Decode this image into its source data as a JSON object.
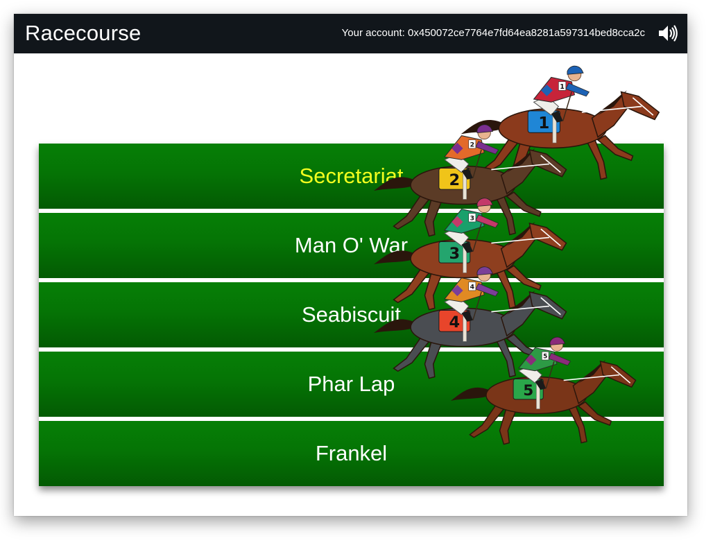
{
  "app": {
    "title": "Racecourse",
    "account_text": "Your account: 0x450072ce7764e7fd64ea8281a597314bed8cca2c",
    "sound_icon": "speaker-volume-icon"
  },
  "lanes": [
    {
      "label": "Secretariat",
      "selected": true
    },
    {
      "label": "Man O' War",
      "selected": false
    },
    {
      "label": "Seabiscuit",
      "selected": false
    },
    {
      "label": "Phar Lap",
      "selected": false
    },
    {
      "label": "Frankel",
      "selected": false
    }
  ],
  "horses": [
    {
      "number": "1",
      "coat": "#8b3a1c",
      "saddle": "#1f86d6",
      "silks": "#c7243a",
      "accent": "#1d62b5"
    },
    {
      "number": "2",
      "coat": "#5b3b26",
      "saddle": "#f0c419",
      "silks": "#e36a2a",
      "accent": "#7a2f8f"
    },
    {
      "number": "3",
      "coat": "#8e3f1f",
      "saddle": "#24a56e",
      "silks": "#19a06b",
      "accent": "#c33a6a"
    },
    {
      "number": "4",
      "coat": "#4a4d52",
      "saddle": "#e8452b",
      "silks": "#e08a23",
      "accent": "#7b3f98"
    },
    {
      "number": "5",
      "coat": "#7a3518",
      "saddle": "#2aa64a",
      "silks": "#2d9a45",
      "accent": "#8a2c7a"
    }
  ],
  "colors": {
    "topbar": "#11161b",
    "lane_green": "#067f06",
    "selected_text": "#f3ff1f"
  }
}
